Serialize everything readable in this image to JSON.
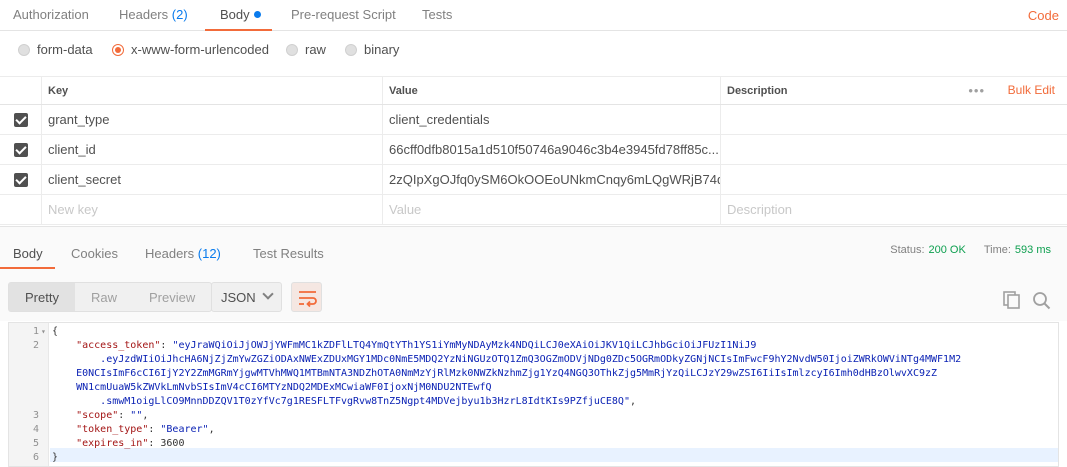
{
  "request_tabs": {
    "authorization": "Authorization",
    "headers_label": "Headers",
    "headers_count": "(2)",
    "body": "Body",
    "prerequest": "Pre-request Script",
    "tests": "Tests",
    "code_link": "Code"
  },
  "body_types": {
    "form_data": "form-data",
    "urlencoded": "x-www-form-urlencoded",
    "raw": "raw",
    "binary": "binary",
    "selected": "x-www-form-urlencoded"
  },
  "params_table": {
    "columns": {
      "key": "Key",
      "value": "Value",
      "description": "Description"
    },
    "more": "•••",
    "bulk_edit": "Bulk Edit",
    "rows": [
      {
        "checked": true,
        "key": "grant_type",
        "value": "client_credentials",
        "description": ""
      },
      {
        "checked": true,
        "key": "client_id",
        "value": "66cff0dfb8015a1d510f50746a9046c3b4e3945fd78ff85c...",
        "description": ""
      },
      {
        "checked": true,
        "key": "client_secret",
        "value": "2zQIpXgOJfq0ySM6OkOOEoUNkmCnqy6mLQgWRjB74d...",
        "description": ""
      }
    ],
    "placeholders": {
      "key": "New key",
      "value": "Value",
      "description": "Description"
    }
  },
  "response": {
    "tabs": {
      "body": "Body",
      "cookies": "Cookies",
      "headers_label": "Headers",
      "headers_count": "(12)",
      "test_results": "Test Results"
    },
    "status_label": "Status:",
    "status_value": "200 OK",
    "time_label": "Time:",
    "time_value": "593 ms",
    "view_modes": {
      "pretty": "Pretty",
      "raw": "Raw",
      "preview": "Preview",
      "active": "Pretty"
    },
    "format": "JSON",
    "code": {
      "line_numbers": [
        "1",
        "2",
        "3",
        "4",
        "5",
        "6"
      ],
      "open_brace": "{",
      "close_brace": "}",
      "access_token_key": "\"access_token\"",
      "access_token_line1": "\"eyJraWQiOiJjOWJjYWFmMC1kZDFlLTQ4YmQtYTh1YS1iYmMyNDAyMzk4NDQiLCJ0eXAiOiJKV1QiLCJhbGciOiJFUzI1NiJ9",
      "access_token_line2": ".eyJzdWIiOiJhcHA6NjZjZmYwZGZiODAxNWExZDUxMGY1MDc0NmE5MDQ2YzNiNGUzOTQ1ZmQ3OGZmODVjNDg0ZDc5OGRmODkyZGNjNCIsImFwcF9hY2NvdW50IjoiZWRkOWViNTg4MWF1M2",
      "access_token_line3": "E0NCIsImF6cCI6IjY2Y2ZmMGRmYjgwMTVhMWQ1MTBmNTA3NDZhOTA0NmMzYjRlMzk0NWZkNzhmZjg1YzQ4NGQ3OThkZjg5MmRjYzQiLCJzY29wZSI6IiIsImlzcyI6Imh0dHBzOlwvXC9zZ",
      "access_token_line4": "WN1cmUuaW5kZWVkLmNvbSIsImV4cCI6MTYzNDQ2MDExMCwiaWF0IjoxNjM0NDU2NTEwfQ",
      "access_token_line5": ".smwM1oigLlCO9MnnDDZQV1T0zYfVc7g1RESFLTFvgRvw8TnZ5Ngpt4MDVejbyu1b3HzrL8IdtKIs9PZfjuCE8Q\"",
      "scope_key": "\"scope\"",
      "scope_value": "\"\"",
      "token_type_key": "\"token_type\"",
      "token_type_value": "\"Bearer\"",
      "expires_in_key": "\"expires_in\"",
      "expires_in_value": "3600"
    }
  },
  "colors": {
    "accent": "#f26b3a",
    "count_blue": "#097bed",
    "status_green": "#0d9f4f",
    "json_key": "#a31515",
    "json_string": "#0b22b4"
  },
  "icons": [
    "checkbox-checked-icon",
    "more-options-icon",
    "chevron-down-icon",
    "wrap-lines-icon",
    "copy-icon",
    "search-icon"
  ]
}
